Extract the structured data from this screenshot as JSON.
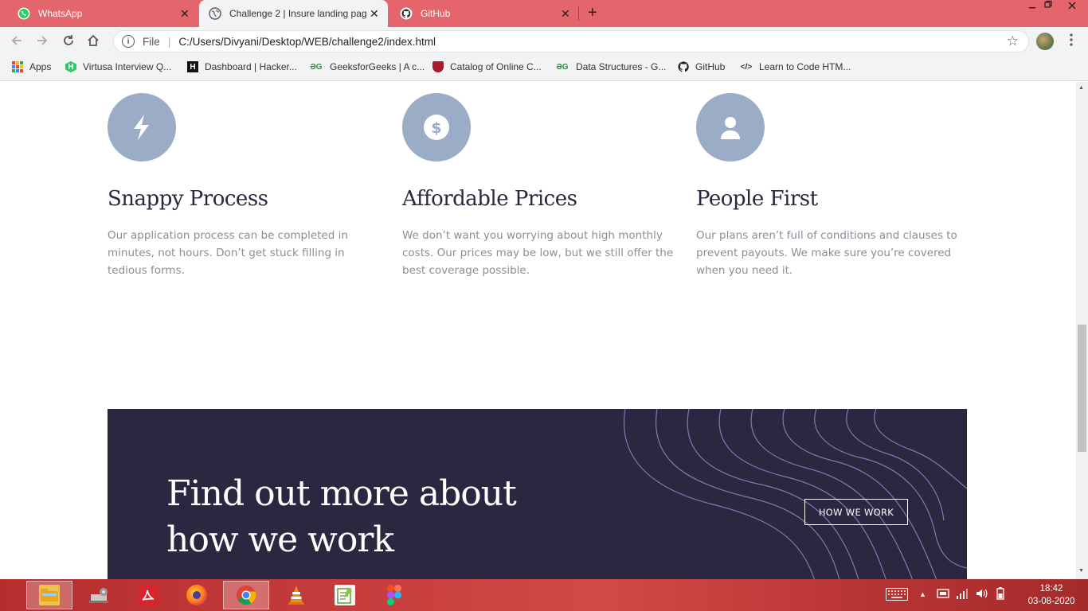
{
  "browser": {
    "tabs": [
      {
        "label": "WhatsApp",
        "close": "✕"
      },
      {
        "label": "Challenge 2 | Insure landing page",
        "close": "✕"
      },
      {
        "label": "GitHub",
        "close": "✕"
      }
    ],
    "new_tab": "+",
    "address": {
      "scheme_label": "File",
      "url": "C:/Users/Divyani/Desktop/WEB/challenge2/index.html"
    },
    "bookmarks": [
      {
        "label": "Apps"
      },
      {
        "label": "Virtusa Interview Q..."
      },
      {
        "label": "Dashboard | Hacker..."
      },
      {
        "label": "GeeksforGeeks | A c..."
      },
      {
        "label": "Catalog of Online C..."
      },
      {
        "label": "Data Structures - G..."
      },
      {
        "label": "GitHub"
      },
      {
        "label": "Learn to Code HTM..."
      }
    ]
  },
  "features": [
    {
      "icon": "lightning-icon",
      "title": "Snappy Process",
      "text": "Our application process can be completed in minutes, not hours. Don’t get stuck filling in tedious forms."
    },
    {
      "icon": "dollar-icon",
      "title": "Affordable Prices",
      "text": "We don’t want you worrying about high monthly costs. Our prices may be low, but we still offer the best coverage possible."
    },
    {
      "icon": "person-icon",
      "title": "People First",
      "text": "Our plans aren’t full of conditions and clauses to prevent payouts. We make sure you’re covered when you need it."
    }
  ],
  "cta": {
    "title": "Find out more about how we work",
    "button": "HOW WE WORK"
  },
  "taskbar": {
    "time": "18:42",
    "date": "03-08-2020"
  },
  "colors": {
    "tab_strip": "#e4656b",
    "feature_icon_bg": "#9bacc7",
    "cta_bg": "#2c2741",
    "heading": "#2b2540",
    "body_text": "#8d8c99"
  }
}
